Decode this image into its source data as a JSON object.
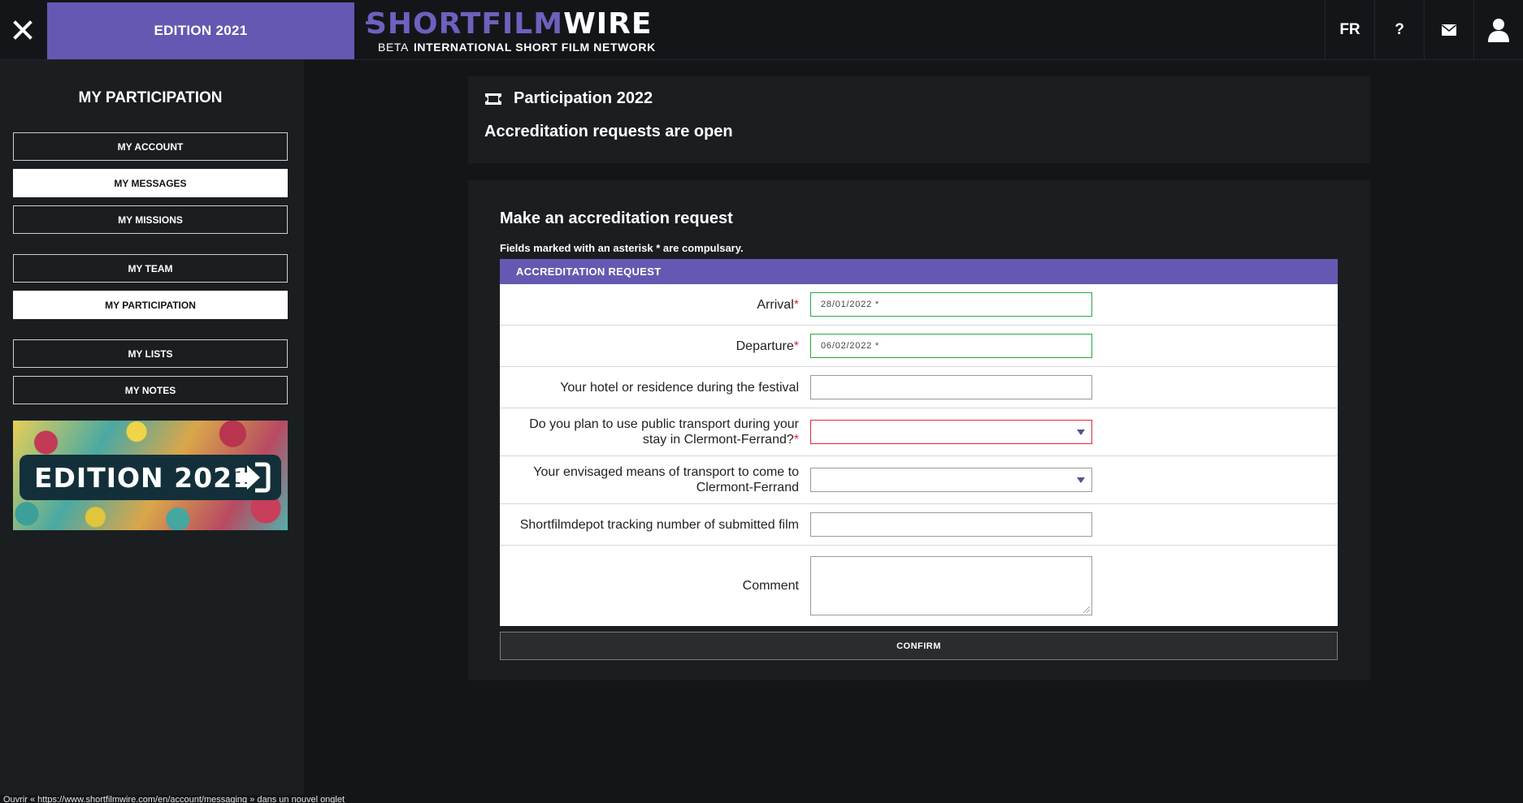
{
  "topbar": {
    "close_icon": "close-icon",
    "edition_label": "EDITION 2021",
    "logo": {
      "part_a": "SHORTFILM",
      "part_b": "WIRE",
      "beta": "BETA",
      "tagline": "INTERNATIONAL SHORT FILM NETWORK"
    },
    "lang_label": "FR",
    "help_label": "?",
    "icons": [
      "help-icon",
      "mail-icon",
      "user-icon"
    ]
  },
  "sidebar": {
    "title": "MY PARTICIPATION",
    "items": [
      {
        "label": "MY ACCOUNT",
        "active": false
      },
      {
        "label": "MY MESSAGES",
        "active": true
      },
      {
        "label": "MY MISSIONS",
        "active": false
      },
      {
        "label": "MY TEAM",
        "active": false
      },
      {
        "label": "MY PARTICIPATION",
        "active": true
      },
      {
        "label": "MY LISTS",
        "active": false
      },
      {
        "label": "MY NOTES",
        "active": false
      }
    ],
    "banner_label": "EDITION 2021"
  },
  "participation": {
    "title": "Participation 2022",
    "status": "Accreditation requests are open"
  },
  "form": {
    "title": "Make an accreditation request",
    "note": "Fields marked with an asterisk * are compulsary.",
    "header": "ACCREDITATION REQUEST",
    "fields": {
      "arrival": {
        "label": "Arrival",
        "value": "28/01/2022 *"
      },
      "departure": {
        "label": "Departure",
        "value": "06/02/2022 *"
      },
      "hotel": {
        "label": "Your hotel or residence during the festival",
        "value": ""
      },
      "public_transport": {
        "label": "Do you plan to use public transport during your stay in Clermont-Ferrand?",
        "value": ""
      },
      "transport_means": {
        "label": "Your envisaged means of transport to come to Clermont-Ferrand",
        "value": ""
      },
      "tracking": {
        "label": "Shortfilmdepot tracking number of submitted film",
        "value": ""
      },
      "comment": {
        "label": "Comment",
        "value": ""
      }
    },
    "required_mark": "*",
    "confirm_label": "CONFIRM"
  },
  "status_bar": {
    "text": "Ouvrir « https://www.shortfilmwire.com/en/account/messaging » dans un nouvel onglet"
  },
  "colors": {
    "accent": "#6459b2",
    "required": "#e0263b",
    "valid": "#27a845",
    "background": "#131619",
    "panel": "#1b1e21"
  }
}
